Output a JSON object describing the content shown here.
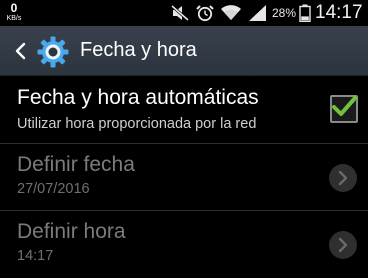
{
  "status_bar": {
    "data_rate_value": "0",
    "data_rate_unit": "KB/s",
    "icons": [
      "mute-icon",
      "alarm-icon",
      "wifi-icon",
      "signal-icon",
      "battery-icon"
    ],
    "battery_percent": "28%",
    "time": "14:17"
  },
  "action_bar": {
    "title": "Fecha y hora",
    "icons": [
      "back-icon",
      "settings-gear-icon"
    ]
  },
  "settings": [
    {
      "title": "Fecha y hora automáticas",
      "subtitle": "Utilizar hora proporcionada por la red",
      "checked": true,
      "enabled": true
    },
    {
      "title": "Definir fecha",
      "subtitle": "27/07/2016",
      "enabled": false
    },
    {
      "title": "Definir hora",
      "subtitle": "14:17",
      "enabled": false
    }
  ],
  "colors": {
    "action_bar": "#38414d",
    "check_green": "#6fc33a",
    "gear_blue": "#3aa0e6"
  }
}
